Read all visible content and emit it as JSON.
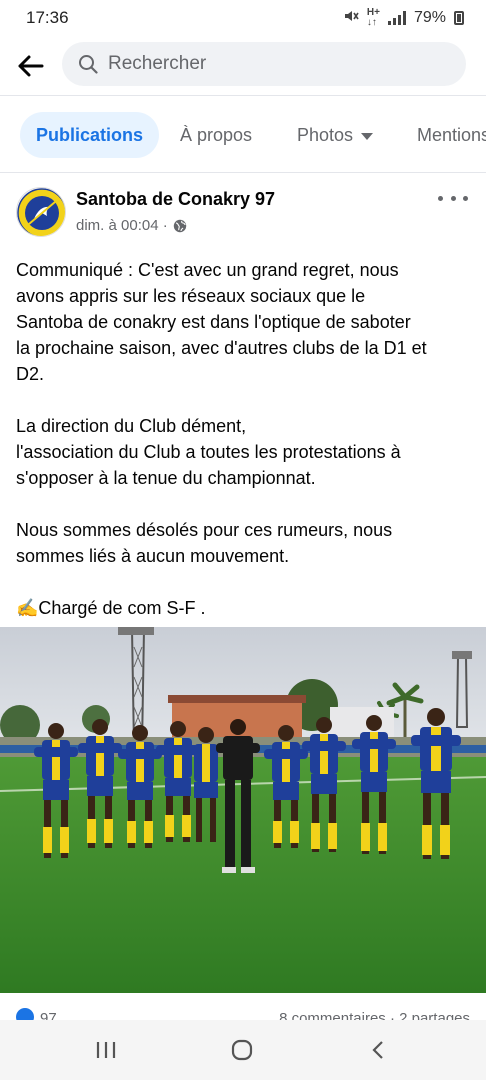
{
  "status_bar": {
    "time": "17:36",
    "battery": "79%"
  },
  "search": {
    "placeholder": "Rechercher"
  },
  "tabs": [
    {
      "label": "Publications",
      "active": true
    },
    {
      "label": "À propos"
    },
    {
      "label": "Photos"
    },
    {
      "label": "Mentions"
    }
  ],
  "post": {
    "page_name": "Santoba de Conakry 97",
    "timestamp": "dim. à 00:04 ·",
    "paragraphs": [
      [
        "Communiqué : C'est avec un grand regret, nous",
        "avons appris sur les réseaux sociaux que le",
        "Santoba de conakry est dans l'optique de saboter",
        "la prochaine saison, avec d'autres clubs de la D1 et",
        "D2."
      ],
      [
        "La direction du Club dément,",
        "l'association du Club a toutes les protestations à",
        "s'opposer à la tenue du championnat."
      ],
      [
        "Nous sommes désolés pour ces rumeurs, nous",
        "sommes liés à aucun mouvement."
      ],
      [
        "✍Chargé de com S-F ."
      ]
    ],
    "reaction_count": "97",
    "comments_shares": "8 commentaires · 2 partages"
  },
  "colors": {
    "accent": "#1b74e4",
    "tab_active_bg": "#e7f3ff",
    "secondary_text": "#65676b",
    "jersey_blue": "#1f3f9a",
    "jersey_yellow": "#f2d21a",
    "grass": "#3e8a2c"
  },
  "icons": {
    "back": "arrow-left-icon",
    "search": "search-icon",
    "more": "more-horizontal-icon",
    "privacy": "globe-icon",
    "like": "like-icon"
  }
}
